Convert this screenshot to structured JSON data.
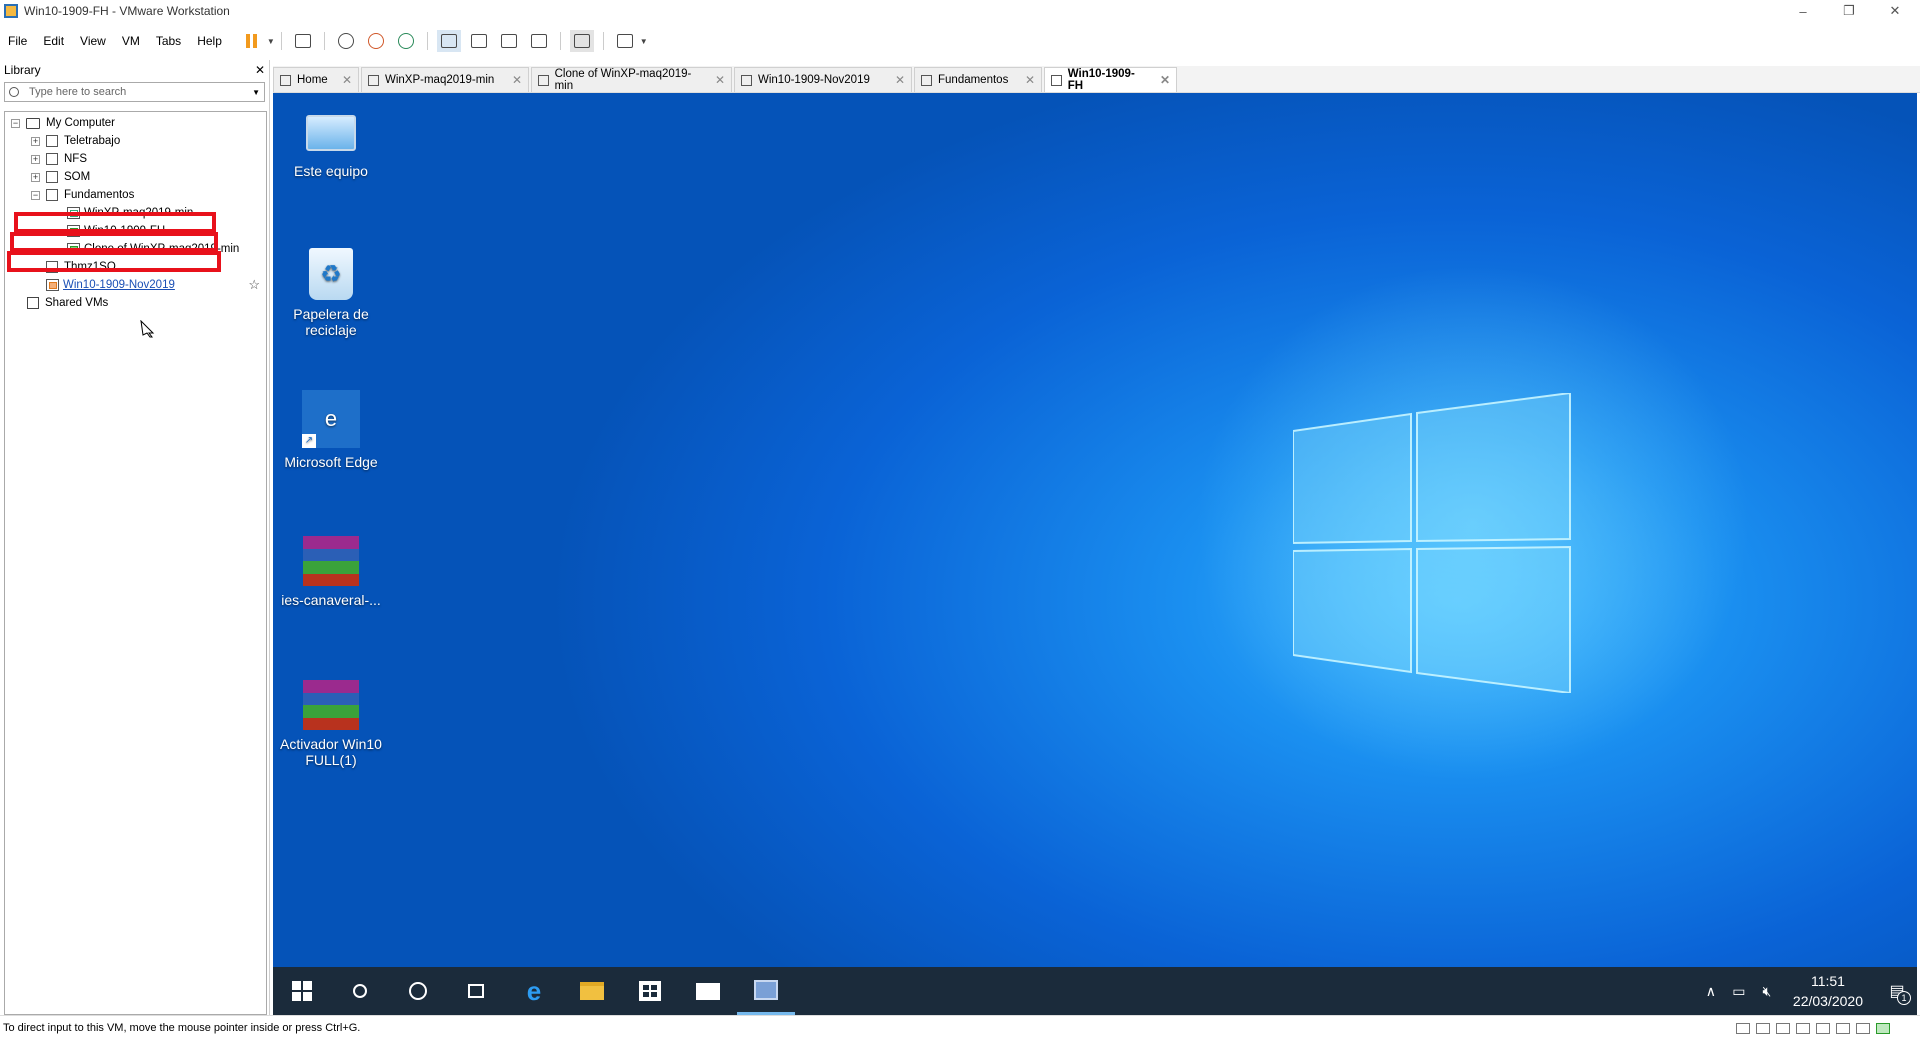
{
  "window": {
    "title": "Win10-1909-FH - VMware Workstation",
    "controls": [
      "–",
      "❐",
      "✕"
    ]
  },
  "menu": [
    "File",
    "Edit",
    "View",
    "VM",
    "Tabs",
    "Help"
  ],
  "library": {
    "title": "Library",
    "close": "✕",
    "search_placeholder": "Type here to search",
    "tree": [
      {
        "label": "My Computer",
        "indent": 0,
        "type": "computer",
        "expander": "−"
      },
      {
        "label": "Teletrabajo",
        "indent": 1,
        "type": "folder",
        "expander": "+"
      },
      {
        "label": "NFS",
        "indent": 1,
        "type": "folder",
        "expander": "+"
      },
      {
        "label": "SOM",
        "indent": 1,
        "type": "folder",
        "expander": "+"
      },
      {
        "label": "Fundamentos",
        "indent": 1,
        "type": "folder",
        "expander": "−"
      },
      {
        "label": "WinXP-maq2019-min",
        "indent": 2,
        "type": "vm"
      },
      {
        "label": "Win10-1909-FH",
        "indent": 2,
        "type": "vm-running"
      },
      {
        "label": "Clone of WinXP-maq2019-min",
        "indent": 2,
        "type": "vm-running"
      },
      {
        "label": "Thmz1SO",
        "indent": 1,
        "type": "folder"
      },
      {
        "label": "Win10-1909-Nov2019",
        "indent": 1,
        "type": "vm-suspended",
        "link": true
      },
      {
        "label": "Shared VMs",
        "indent": 0,
        "type": "shared"
      }
    ]
  },
  "tabs": [
    {
      "label": "Home",
      "active": false
    },
    {
      "label": "WinXP-maq2019-min",
      "active": false
    },
    {
      "label": "Clone of WinXP-maq2019-min",
      "active": false
    },
    {
      "label": "Win10-1909-Nov2019",
      "active": false
    },
    {
      "label": "Fundamentos",
      "active": false
    },
    {
      "label": "Win10-1909-FH",
      "active": true
    }
  ],
  "desktop_icons": [
    {
      "label": "Este equipo",
      "icon": "pc-icon"
    },
    {
      "label": "Papelera de reciclaje",
      "icon": "recycle-bin-icon"
    },
    {
      "label": "Microsoft Edge",
      "icon": "edge-icon"
    },
    {
      "label": "ies-canaveral-...",
      "icon": "winrar-archive-icon"
    },
    {
      "label": "Activador Win10 FULL(1)",
      "icon": "winrar-archive-icon"
    }
  ],
  "taskbar": {
    "time": "11:51",
    "date": "22/03/2020",
    "notification_count": "1"
  },
  "statusbar": {
    "message": "To direct input to this VM, move the mouse pointer inside or press Ctrl+G."
  }
}
